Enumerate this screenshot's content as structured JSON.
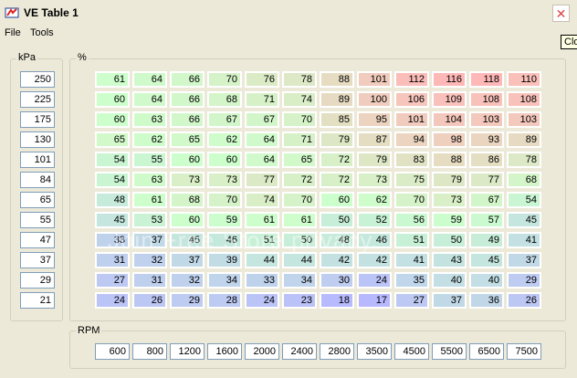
{
  "window": {
    "title": "VE Table 1",
    "close_label": "✕",
    "tooltip": "Clo"
  },
  "menu": [
    "File",
    "Tools"
  ],
  "kpa": {
    "label": "kPa",
    "values": [
      "250",
      "225",
      "175",
      "130",
      "101",
      "84",
      "65",
      "55",
      "47",
      "37",
      "29",
      "21"
    ]
  },
  "percent_label": "%",
  "rpm": {
    "label": "RPM",
    "values": [
      "600",
      "800",
      "1200",
      "1600",
      "2000",
      "2400",
      "2800",
      "3500",
      "4500",
      "5500",
      "6500",
      "7500"
    ]
  },
  "table": [
    [
      "61",
      "64",
      "66",
      "70",
      "76",
      "78",
      "88",
      "101",
      "112",
      "116",
      "118",
      "110"
    ],
    [
      "60",
      "64",
      "66",
      "68",
      "71",
      "74",
      "89",
      "100",
      "106",
      "109",
      "108",
      "108"
    ],
    [
      "60",
      "63",
      "66",
      "67",
      "67",
      "70",
      "85",
      "95",
      "101",
      "104",
      "103",
      "103"
    ],
    [
      "65",
      "62",
      "65",
      "62",
      "64",
      "71",
      "79",
      "87",
      "94",
      "98",
      "93",
      "89"
    ],
    [
      "54",
      "55",
      "60",
      "60",
      "64",
      "65",
      "72",
      "79",
      "83",
      "88",
      "86",
      "78"
    ],
    [
      "54",
      "63",
      "73",
      "73",
      "77",
      "72",
      "72",
      "73",
      "75",
      "79",
      "77",
      "68"
    ],
    [
      "48",
      "61",
      "68",
      "70",
      "74",
      "70",
      "60",
      "62",
      "70",
      "73",
      "67",
      "54"
    ],
    [
      "45",
      "53",
      "60",
      "59",
      "61",
      "61",
      "50",
      "52",
      "56",
      "59",
      "57",
      "45"
    ],
    [
      "33",
      "37",
      "45",
      "46",
      "51",
      "50",
      "48",
      "46",
      "51",
      "50",
      "49",
      "41"
    ],
    [
      "31",
      "32",
      "37",
      "39",
      "44",
      "44",
      "42",
      "42",
      "41",
      "43",
      "45",
      "37"
    ],
    [
      "27",
      "31",
      "32",
      "34",
      "33",
      "34",
      "30",
      "24",
      "35",
      "40",
      "40",
      "29"
    ],
    [
      "24",
      "26",
      "29",
      "28",
      "24",
      "23",
      "18",
      "17",
      "27",
      "37",
      "36",
      "26"
    ]
  ],
  "watermark": "Join Free Store privacy.",
  "colors": {
    "low": "#b8b8ff",
    "mid": "#ccffcc",
    "high": "#ffb8b8"
  }
}
